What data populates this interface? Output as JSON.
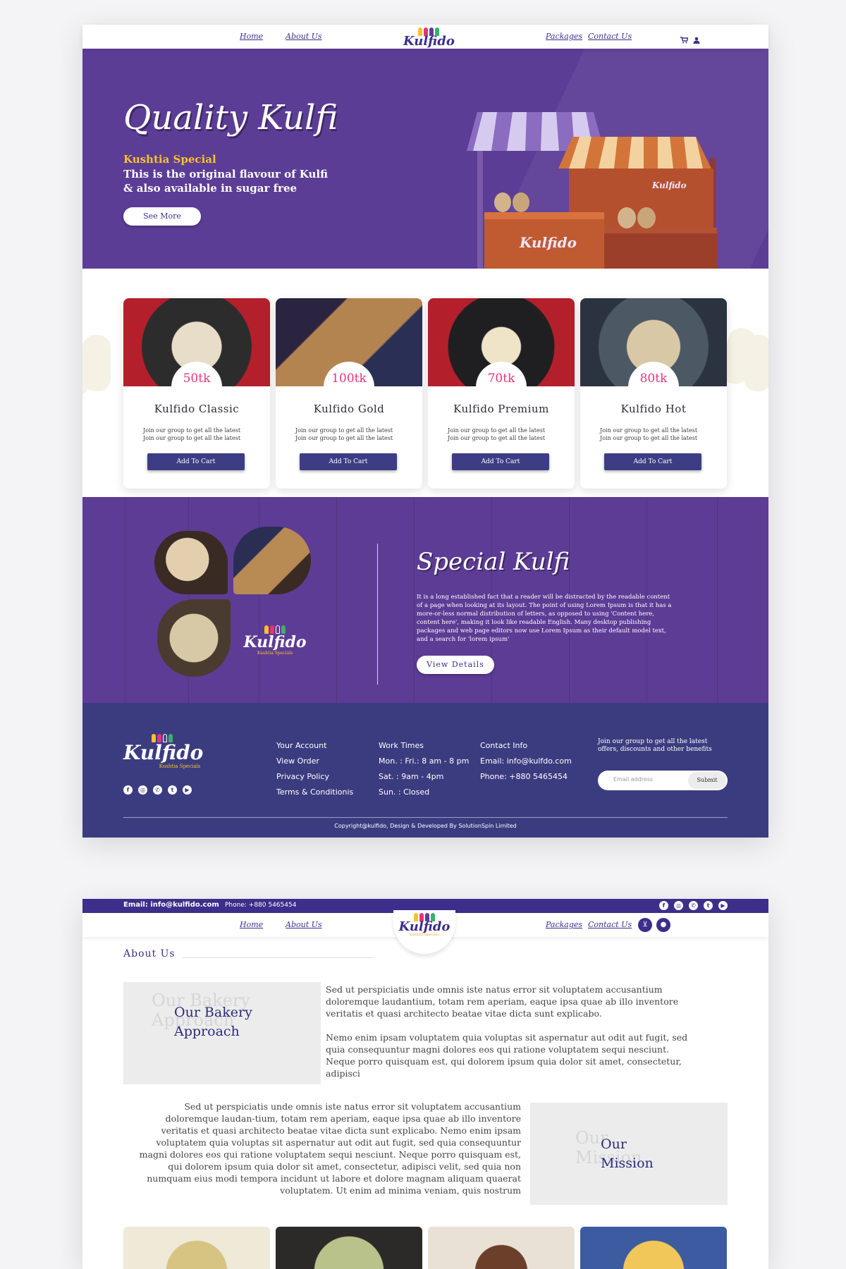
{
  "brand": {
    "logo_text": "Kulfido",
    "logo_tagline": "Kushtia Specials",
    "colors": {
      "primary": "#5c3d96",
      "navy": "#3b3c80",
      "accent_pink": "#e6337a",
      "accent_yellow": "#f7c32a"
    }
  },
  "nav": {
    "home": "Home",
    "about": "About Us",
    "packages": "Packages",
    "contact": "Contact Us",
    "cart_icon": "cart-icon",
    "user_icon": "user-icon"
  },
  "hero": {
    "title": "Quality Kulfi",
    "subtitle": "Kushtia Special",
    "tagline": "This is the original flavour of Kulfi & also available in sugar free",
    "button": "See More",
    "stall_logo": "Kulfido"
  },
  "products": [
    {
      "price": "50tk",
      "name": "Kulfido Classic",
      "desc": "Join our group to get all the latest Join our group to get all the latest",
      "button": "Add To Cart"
    },
    {
      "price": "100tk",
      "name": "Kulfido Gold",
      "desc": "Join our group to get all the latest Join our group to get all the latest",
      "button": "Add To Cart"
    },
    {
      "price": "70tk",
      "name": "Kulfido Premium",
      "desc": "Join our group to get all the latest Join our group to get all the latest",
      "button": "Add To Cart"
    },
    {
      "price": "80tk",
      "name": "Kulfido Hot",
      "desc": "Join our group to get all the latest Join our group to get all the latest",
      "button": "Add To Cart"
    }
  ],
  "special": {
    "title": "Special Kulfi",
    "body": "It is a long established fact that a reader will be distracted by the readable content of a page when looking at its layout. The point of using Lorem Ipsum is that it has a more-or-less normal distribution of letters, as opposed to using 'Content here, content here', making it look like readable English. Many desktop publishing packages and web page editors now use Lorem Ipsum as their default model text, and a search for 'lorem ipsum'",
    "button": "View Details"
  },
  "footer": {
    "account": [
      "Your Account",
      "View Order",
      "Privacy Policy",
      "Terms & Conditionis"
    ],
    "work": [
      "Work Times",
      "Mon. : Fri.: 8 am - 8 pm",
      "Sat. : 9am - 4pm",
      "Sun. : Closed"
    ],
    "contact": [
      "Contact Info",
      "Email: info@kulfdo.com",
      "Phone: +880 5465454"
    ],
    "join_text": "Join our group to get all the latest offers, discounts and other benefits",
    "email_placeholder": "Email address",
    "submit": "Submit",
    "copyright": "Copyright@kulfido, Design & Developed By SolutionSpin Limited",
    "social": [
      "facebook-icon",
      "instagram-icon",
      "whatsapp-icon",
      "twitter-icon",
      "youtube-icon"
    ]
  },
  "page2": {
    "topbar_email": "Email: info@kulfido.com",
    "topbar_phone": "Phone: +880 5465454",
    "about_heading": "About Us",
    "approach_ghost": "Our Bakery Approach",
    "approach_title": "Our Bakery Approach",
    "approach_text": "Sed ut perspiciatis unde omnis iste natus error sit voluptatem accusantium doloremque laudantium, totam rem aperiam, eaque ipsa quae ab illo inventore veritatis et quasi architecto beatae vitae dicta sunt explicabo.",
    "approach_text2": "Nemo enim ipsam voluptatem quia voluptas sit aspernatur aut odit aut fugit, sed quia consequuntur magni dolores eos qui ratione voluptatem sequi nesciunt. Neque porro quisquam est, qui dolorem ipsum quia dolor sit amet, consectetur, adipisci",
    "mission_ghost": "Our Mission",
    "mission_title": "Our Mission",
    "mission_text": "Sed ut perspiciatis unde omnis iste natus error sit voluptatem accusantium doloremque laudan-tium, totam rem aperiam, eaque ipsa quae ab illo inventore veritatis et quasi architecto beatae vitae dicta sunt explicabo. Nemo enim ipsam voluptatem quia voluptas sit aspernatur aut odit aut fugit, sed quia consequuntur magni dolores eos qui ratione voluptatem sequi nesciunt. Neque porro quisquam est, qui dolorem ipsum quia dolor sit amet, consectetur, adipisci velit, sed quia non numquam eius modi tempora incidunt ut labore et dolore magnam aliquam quaerat voluptatem. Ut enim ad minima veniam, quis nostrum"
  }
}
